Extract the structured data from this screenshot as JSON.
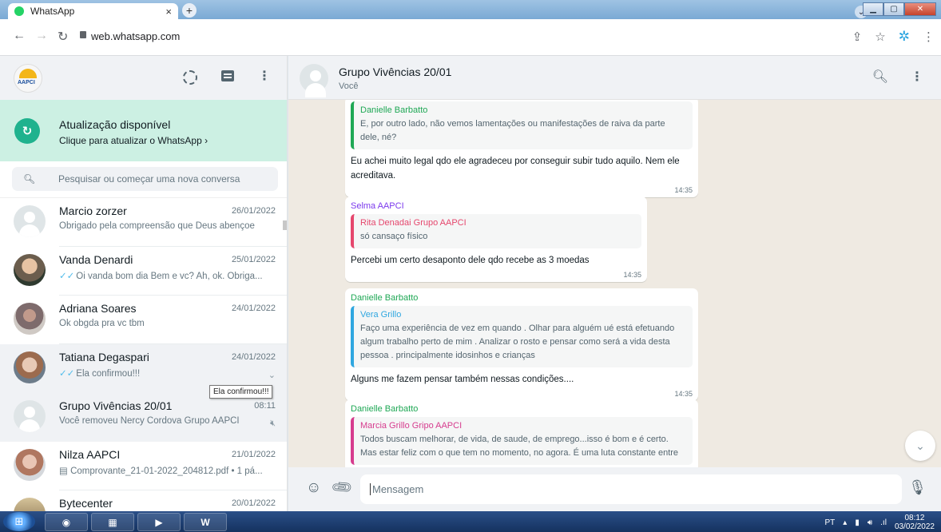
{
  "browser": {
    "tab_title": "WhatsApp",
    "tab_close": "×",
    "new_tab": "+",
    "url": "web.whatsapp.com"
  },
  "sidebar": {
    "avatar_text": "AAPCI",
    "update": {
      "title": "Atualização disponível",
      "subtitle": "Clique para atualizar o WhatsApp ›"
    },
    "search_placeholder": "Pesquisar ou começar uma nova conversa",
    "chats": [
      {
        "name": "Marcio zorzer",
        "date": "26/01/2022",
        "preview": "Obrigado pela compreensão que Deus abençoe",
        "ticks": ""
      },
      {
        "name": "Vanda Denardi",
        "date": "25/01/2022",
        "preview": "Oi vanda bom dia Bem e vc? Ah, ok. Obriga...",
        "ticks": "✓✓"
      },
      {
        "name": "Adriana Soares",
        "date": "24/01/2022",
        "preview": "Ok  obgda pra vc tbm",
        "ticks": ""
      },
      {
        "name": "Tatiana Degaspari",
        "date": "24/01/2022",
        "preview": "Ela confirmou!!!",
        "ticks": "✓✓"
      },
      {
        "name": "Grupo Vivências 20/01",
        "date": "08:11",
        "preview": "Você removeu Nercy Cordova Grupo AAPCI",
        "ticks": ""
      },
      {
        "name": "Nilza AAPCI",
        "date": "21/01/2022",
        "preview": "Comprovante_21-01-2022_204812.pdf • 1 pá...",
        "ticks": ""
      },
      {
        "name": "Bytecenter",
        "date": "20/01/2022",
        "preview": "",
        "ticks": ""
      }
    ],
    "tooltip": "Ela confirmou!!!"
  },
  "conversation": {
    "title": "Grupo Vivências 20/01",
    "subtitle": "Você",
    "messages": [
      {
        "sender": "",
        "quote_name": "Danielle Barbatto",
        "quote_text": "E, por outro lado, não vemos lamentações ou manifestações de raiva da parte dele, né?",
        "body": "Eu achei muito legal qdo ele agradeceu por conseguir  subir tudo aquilo. Nem ele acreditava.",
        "time": "14:35"
      },
      {
        "sender": "Selma AAPCI",
        "quote_name": "Rita Denadai Grupo AAPCI",
        "quote_text": "só cansaço físico",
        "body": "Percebi um certo desaponto dele qdo recebe as 3 moedas",
        "time": "14:35"
      },
      {
        "sender": "Danielle Barbatto",
        "quote_name": "Vera Grillo",
        "quote_text": "Faço uma experiência de vez em quando . Olhar para alguém ué está efetuando algum trabalho perto de mim . Analizar o rosto  e pensar como será a vida desta pessoa . principalmente idosinhos e crianças",
        "body": "Alguns me fazem pensar também nessas condições....",
        "time": "14:35"
      },
      {
        "sender": "Danielle Barbatto",
        "quote_name": "Marcia Grillo Gripo AAPCI",
        "quote_text": "Todos buscam melhorar, de vida, de saude, de emprego...isso é bom e é certo. Mas estar feliz com o que tem no momento, no agora. É uma luta constante entre",
        "body": "",
        "time": ""
      }
    ],
    "compose_placeholder": "Mensagem"
  },
  "taskbar": {
    "lang": "PT",
    "time": "08:12",
    "date": "03/02/2022"
  },
  "colors": {
    "accent": "#00a884",
    "update_bg": "#ccf0e3",
    "chat_bg": "#efeae2",
    "danielle": "#1fa855",
    "selma": "#7c3aed",
    "rita": "#e5476d",
    "vera": "#30a7e0",
    "marcia": "#d63c8e"
  }
}
